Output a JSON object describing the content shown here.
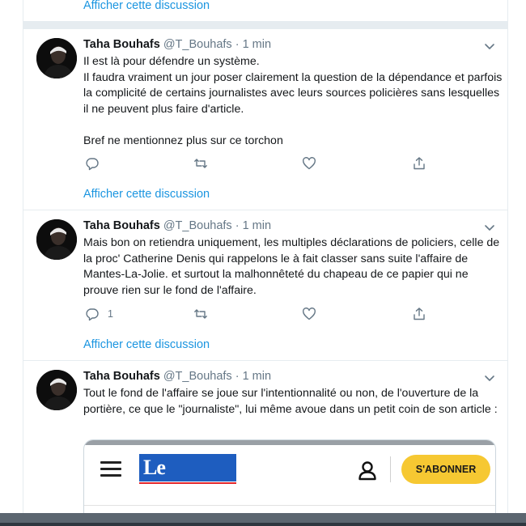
{
  "show_thread_label": "Afficher cette discussion",
  "tweets": [
    {
      "name": "Taha Bouhafs",
      "handle": "@T_Bouhafs",
      "dot": "·",
      "time": "1 min",
      "text": "Il est là pour défendre un système.\nIl faudra vraiment un jour poser clairement la question de la dépendance et parfois la complicité de certains journalistes avec leurs sources policières sans lesquelles il ne peuvent plus faire d'article.\n\nBref ne mentionnez plus sur ce torchon",
      "reply_count": "",
      "show_thread": "Afficher cette discussion"
    },
    {
      "name": "Taha Bouhafs",
      "handle": "@T_Bouhafs",
      "dot": "·",
      "time": "1 min",
      "text": "Mais bon on retiendra uniquement, les multiples déclarations de policiers, celle de la proc' Catherine Denis qui rappelons le à fait classer sans suite l'affaire de Mantes-La-Jolie. et surtout la malhonnêteté du chapeau de ce papier qui ne prouve rien sur le fond de l'affaire.",
      "reply_count": "1",
      "show_thread": "Afficher cette discussion"
    },
    {
      "name": "Taha Bouhafs",
      "handle": "@T_Bouhafs",
      "dot": "·",
      "time": "1 min",
      "text": "Tout le fond de l'affaire se joue sur l'intentionnalité ou non, de l'ouverture de la portière, ce que le \"journaliste\", lui même avoue dans un petit coin de son article :"
    }
  ],
  "card": {
    "logo_text": "Le Parisien",
    "subscribe_label": "S'ABONNER"
  },
  "colors": {
    "link": "#1b95e0",
    "muted": "#657786",
    "logo_blue": "#1e5dbf",
    "subscribe_yellow": "#f6c832"
  },
  "icons": [
    "reply-icon",
    "retweet-icon",
    "like-icon",
    "share-icon",
    "chevron-down-icon",
    "menu-icon",
    "user-icon"
  ]
}
